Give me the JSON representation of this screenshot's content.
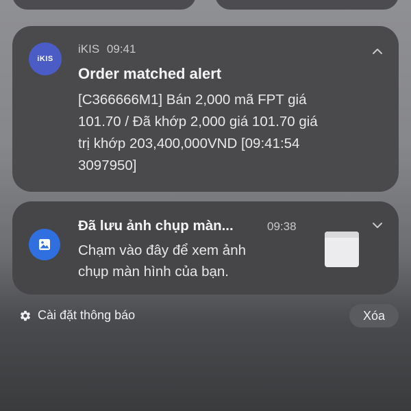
{
  "notifications": [
    {
      "app_icon_text": "iKIS",
      "app_name": "iKIS",
      "time": "09:41",
      "title": "Order matched alert",
      "body": "[C366666M1] Bán 2,000 mã FPT giá\n101.70 / Đã khớp 2,000 giá 101.70 giá\ntrị khớp 203,400,000VND [09:41:54\n3097950]",
      "icon": "ikis-app-icon",
      "toggle_icon": "chevron-up-icon",
      "accent": "#4c5cc6"
    },
    {
      "title": "Đã lưu ảnh chụp màn...",
      "time": "09:38",
      "body": "Chạm vào đây để xem ảnh\nchụp màn hình của bạn.",
      "icon": "image-icon",
      "toggle_icon": "chevron-down-icon",
      "accent": "#2f6fe0"
    }
  ],
  "footer": {
    "settings_label": "Cài đặt thông báo",
    "settings_icon": "gear-icon",
    "clear_label": "Xóa"
  }
}
